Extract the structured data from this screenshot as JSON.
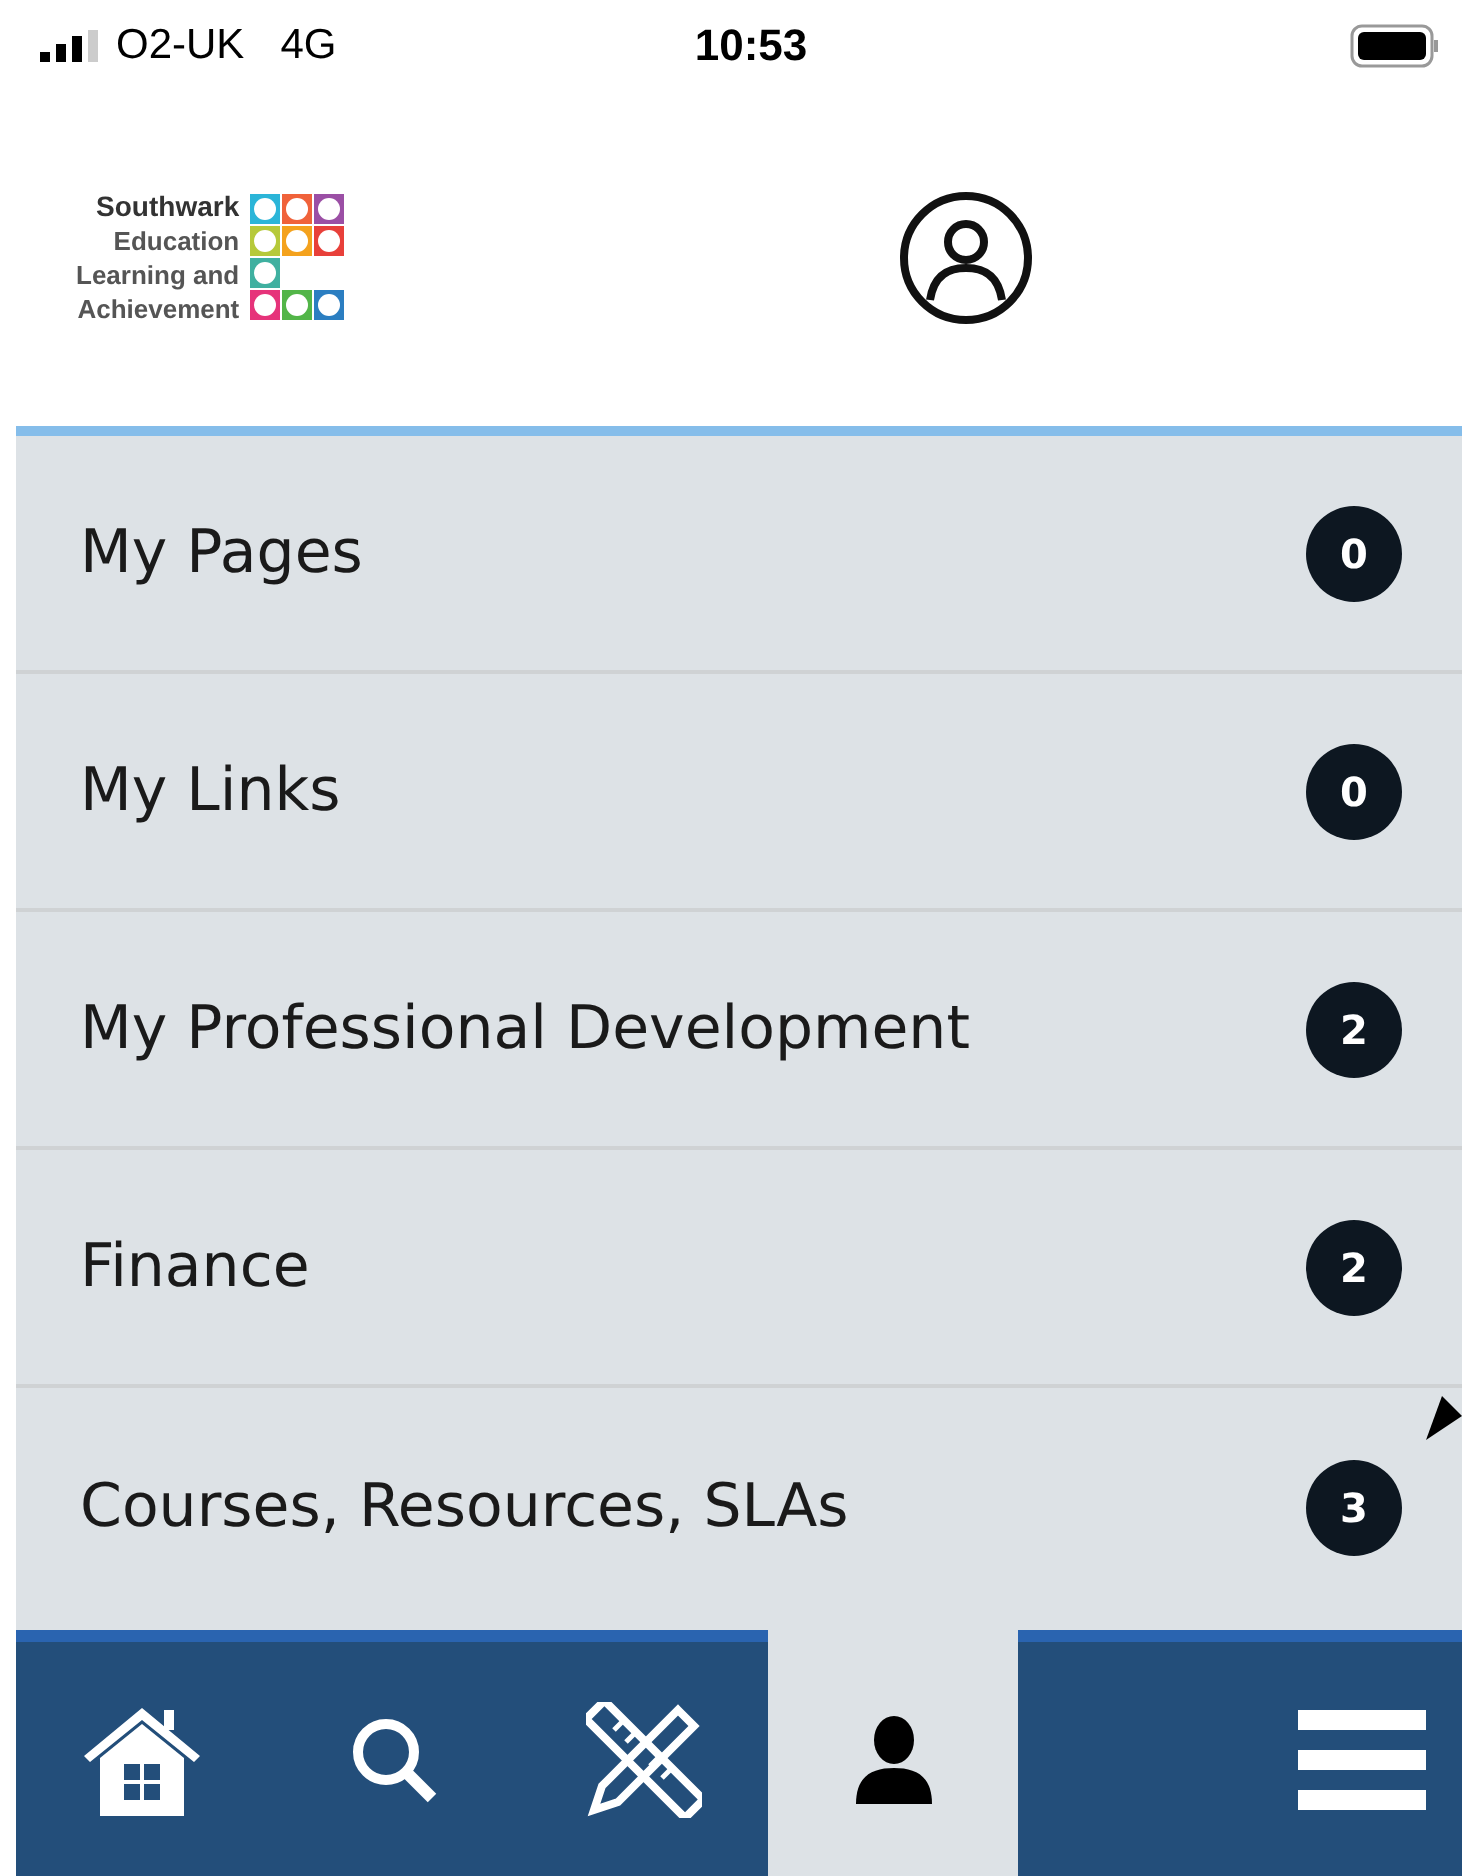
{
  "status_bar": {
    "carrier": "O2-UK",
    "network": "4G",
    "time": "10:53"
  },
  "header": {
    "logo_lines": [
      "Southwark",
      "Education",
      "Learning and",
      "Achievement"
    ]
  },
  "menu_items": [
    {
      "label": "My Pages",
      "count": "0"
    },
    {
      "label": "My Links",
      "count": "0"
    },
    {
      "label": "My Professional Development",
      "count": "2"
    },
    {
      "label": "Finance",
      "count": "2"
    },
    {
      "label": "Courses, Resources, SLAs",
      "count": "3"
    }
  ],
  "tab_bar": [
    {
      "kind": "home",
      "selected": false
    },
    {
      "kind": "search",
      "selected": false
    },
    {
      "kind": "tools",
      "selected": false
    },
    {
      "kind": "profile",
      "selected": true
    },
    {
      "kind": "menu",
      "selected": false
    }
  ]
}
